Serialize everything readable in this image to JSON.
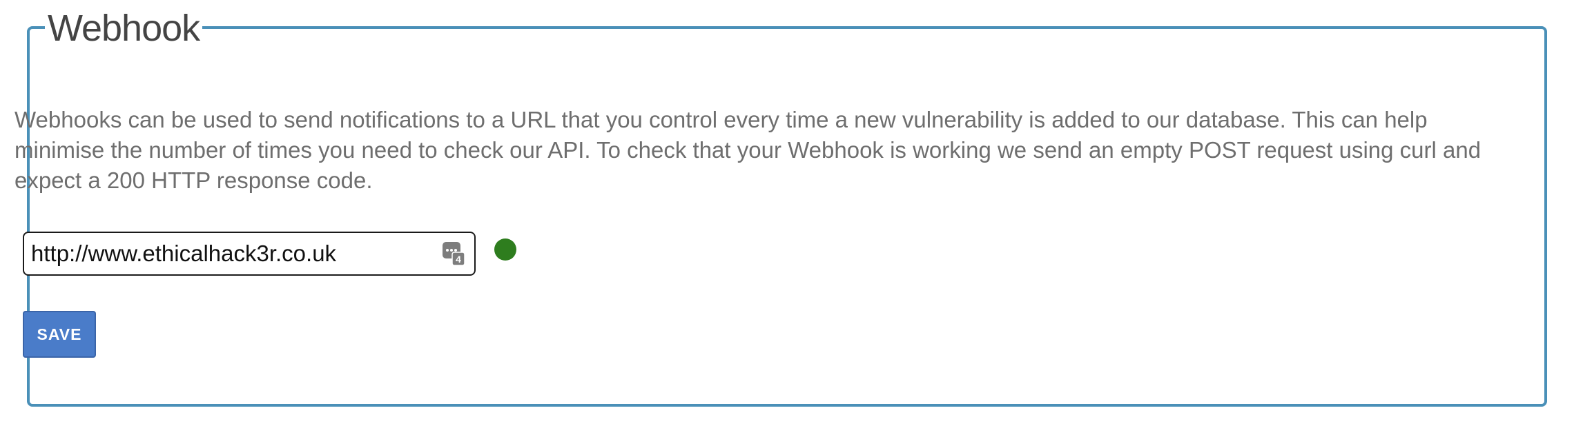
{
  "panel": {
    "title": "Webhook",
    "description": "Webhooks can be used to send notifications to a URL that you control every time a new vulnerability is added to our database. This can help minimise the number of times you need to check our API. To check that your Webhook is working we send an empty POST request using curl and expect a 200 HTTP response code."
  },
  "webhook_url": {
    "value": "http://www.ethicalhack3r.co.uk",
    "placeholder": "",
    "password_manager_icon": "password-manager-icon",
    "password_manager_count": "4"
  },
  "status": {
    "icon": "status-dot-icon",
    "color": "#2e7d1e"
  },
  "save_button": {
    "label": "SAVE",
    "color": "#4a7cc9"
  },
  "colors": {
    "border": "#4a90b8",
    "text": "#6e6e6e"
  }
}
